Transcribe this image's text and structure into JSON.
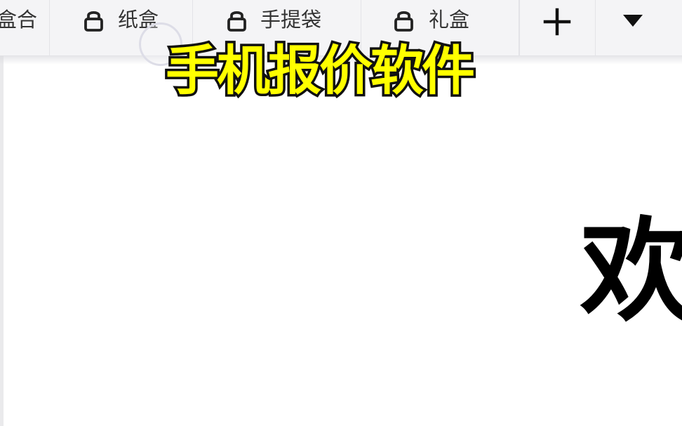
{
  "tabs": [
    {
      "label": "盒合",
      "locked": false,
      "partial": true
    },
    {
      "label": "纸盒",
      "locked": true,
      "icon": "lock-icon"
    },
    {
      "label": "手提袋",
      "locked": true,
      "icon": "lock-icon"
    },
    {
      "label": "礼盒",
      "locked": true,
      "icon": "lock-icon"
    }
  ],
  "tab_actions": {
    "add_icon": "plus-icon",
    "dropdown_icon": "triangle-down-icon"
  },
  "video_caption": "手机报价软件",
  "welcome_text": "欢",
  "colors": {
    "tabbar_background": "#f4f4f6",
    "tab_text": "#333333",
    "caption_fill": "#ffff00",
    "caption_stroke": "#111111",
    "content_background": "#ffffff",
    "welcome_text": "#000000"
  }
}
